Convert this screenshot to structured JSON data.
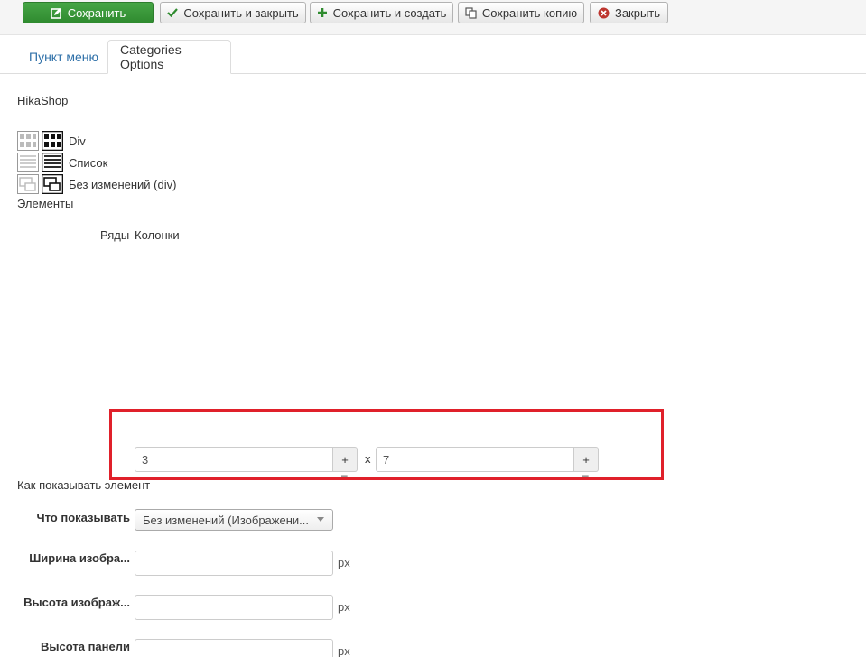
{
  "toolbar": {
    "save": "Сохранить",
    "save_close": "Сохранить и закрыть",
    "save_new": "Сохранить и создать",
    "save_copy": "Сохранить копию",
    "close": "Закрыть"
  },
  "tabs": [
    {
      "label": "Пункт меню",
      "active": false
    },
    {
      "label": "Categories Options",
      "active": true
    }
  ],
  "section_title": "HikaShop",
  "layouts": [
    {
      "label": "Div",
      "icon": "grid-layout-icon"
    },
    {
      "label": "Список",
      "icon": "list-layout-icon"
    },
    {
      "label": "Без изменений (div)",
      "icon": "inherit-layout-icon"
    }
  ],
  "elements_label": "Элементы",
  "rows_label": "Ряды",
  "columns_label": "Колонки",
  "rows_value": "3",
  "columns_value": "7",
  "stepper_plus": "+",
  "stepper_minus": "–",
  "times_sign": "x",
  "display_section_label": "Как показывать элемент",
  "form": {
    "show_what_label": "Что показывать",
    "show_what_value": "Без изменений (Изображени...",
    "image_width_label": "Ширина изобра...",
    "image_height_label": "Высота изображ...",
    "panel_height_label": "Высота панели",
    "unit": "px"
  },
  "colors": {
    "primary_button": "#46a546",
    "highlight_border": "#e0202a",
    "link": "#3071a9"
  }
}
